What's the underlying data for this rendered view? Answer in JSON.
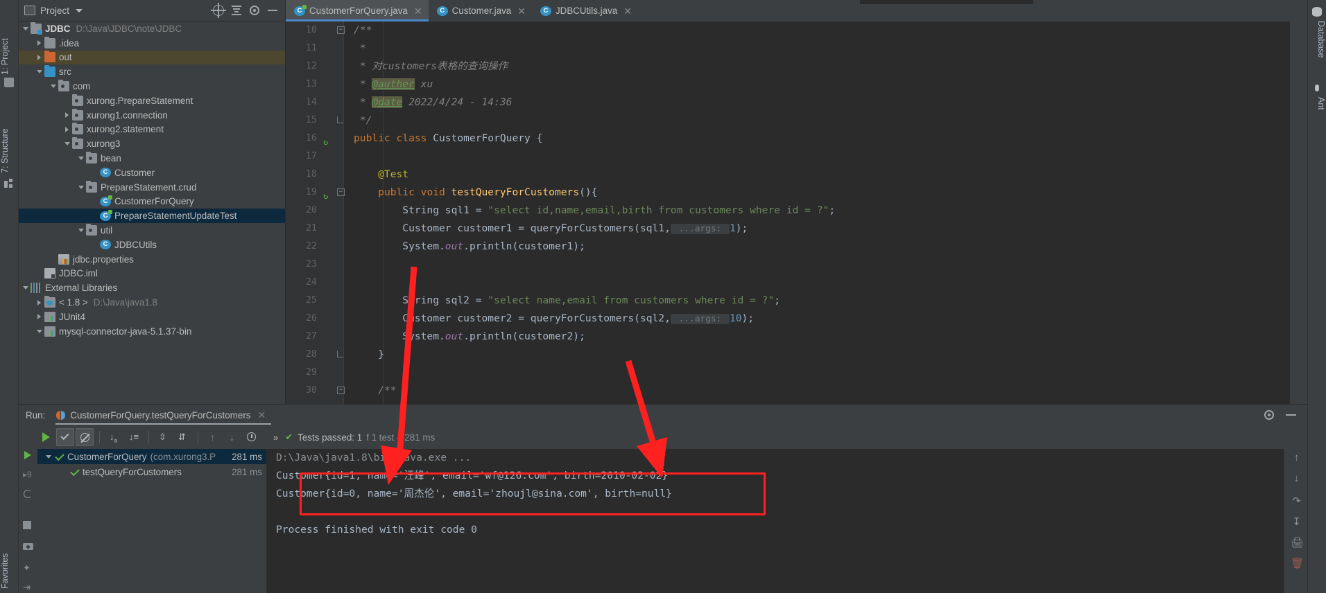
{
  "window": {
    "left_tool_labels": [
      "1: Project",
      "7: Structure",
      "Favorites"
    ],
    "right_tool_labels": [
      "Database",
      "Ant"
    ]
  },
  "project_panel": {
    "title": "Project",
    "toolbar_icons": [
      "locate-icon",
      "collapse-all-icon",
      "settings-icon",
      "hide-icon"
    ],
    "tree": [
      {
        "indent": 0,
        "arrow": "down",
        "icon": "folder-module",
        "label": "JDBC",
        "bold": true,
        "sub": "D:\\Java\\JDBC\\note\\JDBC",
        "state": "normal"
      },
      {
        "indent": 1,
        "arrow": "right",
        "icon": "folder",
        "label": ".idea",
        "sub": "",
        "state": "normal"
      },
      {
        "indent": 1,
        "arrow": "right",
        "icon": "folder-orange",
        "label": "out",
        "sub": "",
        "state": "highlight"
      },
      {
        "indent": 1,
        "arrow": "down",
        "icon": "folder-blue",
        "label": "src",
        "sub": "",
        "state": "normal"
      },
      {
        "indent": 2,
        "arrow": "down",
        "icon": "package",
        "label": "com",
        "sub": "",
        "state": "normal"
      },
      {
        "indent": 3,
        "arrow": "none",
        "icon": "package",
        "label": "xurong.PrepareStatement",
        "sub": "",
        "state": "normal"
      },
      {
        "indent": 3,
        "arrow": "right",
        "icon": "package",
        "label": "xurong1.connection",
        "sub": "",
        "state": "normal"
      },
      {
        "indent": 3,
        "arrow": "right",
        "icon": "package",
        "label": "xurong2.statement",
        "sub": "",
        "state": "normal"
      },
      {
        "indent": 3,
        "arrow": "down",
        "icon": "package",
        "label": "xurong3",
        "sub": "",
        "state": "normal"
      },
      {
        "indent": 4,
        "arrow": "down",
        "icon": "package",
        "label": "bean",
        "sub": "",
        "state": "normal"
      },
      {
        "indent": 5,
        "arrow": "none",
        "icon": "class",
        "label": "Customer",
        "sub": "",
        "state": "normal"
      },
      {
        "indent": 4,
        "arrow": "down",
        "icon": "package",
        "label": "PrepareStatement.crud",
        "sub": "",
        "state": "normal"
      },
      {
        "indent": 5,
        "arrow": "none",
        "icon": "class-runnable",
        "label": "CustomerForQuery",
        "sub": "",
        "state": "normal"
      },
      {
        "indent": 5,
        "arrow": "none",
        "icon": "class-runnable",
        "label": "PrepareStatementUpdateTest",
        "sub": "",
        "state": "selected"
      },
      {
        "indent": 4,
        "arrow": "down",
        "icon": "package",
        "label": "util",
        "sub": "",
        "state": "normal"
      },
      {
        "indent": 5,
        "arrow": "none",
        "icon": "class",
        "label": "JDBCUtils",
        "sub": "",
        "state": "normal"
      },
      {
        "indent": 2,
        "arrow": "none",
        "icon": "properties",
        "label": "jdbc.properties",
        "sub": "",
        "state": "normal"
      },
      {
        "indent": 1,
        "arrow": "none",
        "icon": "iml",
        "label": "JDBC.iml",
        "sub": "",
        "state": "normal"
      },
      {
        "indent": 0,
        "arrow": "down",
        "icon": "libraries",
        "label": "External Libraries",
        "sub": "",
        "state": "normal"
      },
      {
        "indent": 1,
        "arrow": "right",
        "icon": "jdk",
        "label": "< 1.8 >",
        "sub": "D:\\Java\\java1.8",
        "state": "normal"
      },
      {
        "indent": 1,
        "arrow": "right",
        "icon": "jar",
        "label": "JUnit4",
        "sub": "",
        "state": "normal"
      },
      {
        "indent": 1,
        "arrow": "down",
        "icon": "jar",
        "label": "mysql-connector-java-5.1.37-bin",
        "sub": "",
        "state": "normal"
      }
    ]
  },
  "editor": {
    "tabs": [
      {
        "label": "CustomerForQuery.java",
        "icon": "class-runnable-icon",
        "active": true
      },
      {
        "label": "Customer.java",
        "icon": "class-icon",
        "active": false
      },
      {
        "label": "JDBCUtils.java",
        "icon": "class-icon",
        "active": false
      }
    ],
    "first_line_number": 10,
    "lines": [
      {
        "n": 10,
        "fold": "start",
        "gutter_mark": "",
        "tokens": [
          {
            "t": "/**",
            "c": "cmt"
          }
        ],
        "indent": 0
      },
      {
        "n": 11,
        "fold": "",
        "gutter_mark": "",
        "tokens": [
          {
            "t": " *",
            "c": "cmt"
          }
        ],
        "indent": 1
      },
      {
        "n": 12,
        "fold": "",
        "gutter_mark": "",
        "tokens": [
          {
            "t": " * 对customers表格的查询操作",
            "c": "cmt"
          }
        ],
        "indent": 1
      },
      {
        "n": 13,
        "fold": "",
        "gutter_mark": "",
        "tokens": [
          {
            "t": " * ",
            "c": "cmt"
          },
          {
            "t": "@auther",
            "c": "tagc"
          },
          {
            "t": " xu",
            "c": "cmt"
          }
        ],
        "indent": 1
      },
      {
        "n": 14,
        "fold": "",
        "gutter_mark": "",
        "tokens": [
          {
            "t": " * ",
            "c": "cmt"
          },
          {
            "t": "@date",
            "c": "tagc"
          },
          {
            "t": " 2022/4/24 - 14:36",
            "c": "cmt"
          }
        ],
        "indent": 1
      },
      {
        "n": 15,
        "fold": "end",
        "gutter_mark": "",
        "tokens": [
          {
            "t": " */",
            "c": "cmt"
          }
        ],
        "indent": 1
      },
      {
        "n": 16,
        "fold": "",
        "gutter_mark": "run",
        "tokens": [
          {
            "t": "public class ",
            "c": "kw"
          },
          {
            "t": "CustomerForQuery {",
            "c": "cm"
          }
        ],
        "indent": 0
      },
      {
        "n": 17,
        "fold": "",
        "gutter_mark": "",
        "tokens": [],
        "indent": 0
      },
      {
        "n": 18,
        "fold": "",
        "gutter_mark": "",
        "tokens": [
          {
            "t": "    @Test",
            "c": "anno"
          }
        ],
        "indent": 0
      },
      {
        "n": 19,
        "fold": "start",
        "gutter_mark": "run",
        "tokens": [
          {
            "t": "    ",
            "c": "cm"
          },
          {
            "t": "public void ",
            "c": "kw"
          },
          {
            "t": "testQueryForCustomers",
            "c": "fn"
          },
          {
            "t": "(){",
            "c": "cm"
          }
        ],
        "indent": 0
      },
      {
        "n": 20,
        "fold": "",
        "gutter_mark": "",
        "tokens": [
          {
            "t": "        String sql1 = ",
            "c": "cm"
          },
          {
            "t": "\"select id,name,email,birth from customers where id = ?\"",
            "c": "str"
          },
          {
            "t": ";",
            "c": "cm"
          }
        ],
        "indent": 0
      },
      {
        "n": 21,
        "fold": "",
        "gutter_mark": "",
        "tokens": [
          {
            "t": "        Customer customer1 = queryForCustomers(sql1,",
            "c": "cm"
          },
          {
            "t": " ...args: ",
            "c": "hint"
          },
          {
            "t": "1",
            "c": "num"
          },
          {
            "t": ");",
            "c": "cm"
          }
        ],
        "indent": 0
      },
      {
        "n": 22,
        "fold": "",
        "gutter_mark": "",
        "tokens": [
          {
            "t": "        System.",
            "c": "cm"
          },
          {
            "t": "out",
            "c": "fld"
          },
          {
            "t": ".println(customer1);",
            "c": "cm"
          }
        ],
        "indent": 0
      },
      {
        "n": 23,
        "fold": "",
        "gutter_mark": "",
        "tokens": [],
        "indent": 0
      },
      {
        "n": 24,
        "fold": "",
        "gutter_mark": "",
        "tokens": [],
        "indent": 0
      },
      {
        "n": 25,
        "fold": "",
        "gutter_mark": "",
        "tokens": [
          {
            "t": "        String sql2 = ",
            "c": "cm"
          },
          {
            "t": "\"select name,email from customers where id = ?\"",
            "c": "str"
          },
          {
            "t": ";",
            "c": "cm"
          }
        ],
        "indent": 0
      },
      {
        "n": 26,
        "fold": "",
        "gutter_mark": "",
        "tokens": [
          {
            "t": "        Customer customer2 = queryForCustomers(sql2,",
            "c": "cm"
          },
          {
            "t": " ...args: ",
            "c": "hint"
          },
          {
            "t": "10",
            "c": "num"
          },
          {
            "t": ");",
            "c": "cm"
          }
        ],
        "indent": 0
      },
      {
        "n": 27,
        "fold": "",
        "gutter_mark": "",
        "tokens": [
          {
            "t": "        System.",
            "c": "cm"
          },
          {
            "t": "out",
            "c": "fld"
          },
          {
            "t": ".println(customer2);",
            "c": "cm"
          }
        ],
        "indent": 0
      },
      {
        "n": 28,
        "fold": "end",
        "gutter_mark": "",
        "tokens": [
          {
            "t": "    }",
            "c": "cm"
          }
        ],
        "indent": 0
      },
      {
        "n": 29,
        "fold": "",
        "gutter_mark": "",
        "tokens": [],
        "indent": 0
      },
      {
        "n": 30,
        "fold": "start",
        "gutter_mark": "",
        "tokens": [
          {
            "t": "    /**",
            "c": "cmt"
          }
        ],
        "indent": 0
      }
    ]
  },
  "run_window": {
    "label": "Run:",
    "config_name": "CustomerForQuery.testQueryForCustomers",
    "toolbar": {
      "rerun": "rerun-button",
      "toggle_passed": "show-passed-toggle",
      "toggle_ignored": "show-ignored-toggle",
      "sort_alpha": "sort-alphabetically-button",
      "sort_duration": "sort-by-duration-button",
      "expand_all": "expand-all-button",
      "collapse_all": "collapse-all-button",
      "prev_test": "previous-failed-test-button",
      "next_test": "next-failed-test-button",
      "history": "test-history-button",
      "more": "»"
    },
    "status": {
      "prefix": "Tests passed: 1",
      "suffix": "f 1 test – 281 ms"
    },
    "tests": [
      {
        "indent": 0,
        "arrow": "down",
        "name": "CustomerForQuery",
        "pkg": "(com.xurong3.P",
        "time": "281 ms",
        "selected": true
      },
      {
        "indent": 1,
        "arrow": "none",
        "name": "testQueryForCustomers",
        "pkg": "",
        "time": "281 ms",
        "selected": false
      }
    ],
    "console": [
      {
        "text": "D:\\Java\\java1.8\\bin\\java.exe ...",
        "style": "cmd"
      },
      {
        "text": "Customer{id=1, name='汪峰', email='wf@126.com', birth=2010-02-02}",
        "style": "out"
      },
      {
        "text": "Customer{id=0, name='周杰伦', email='zhoujl@sina.com', birth=null}",
        "style": "out"
      },
      {
        "text": "",
        "style": "out"
      },
      {
        "text": "Process finished with exit code 0",
        "style": "out"
      }
    ],
    "left_icons": [
      "run-icon",
      "rerun-failed-icon",
      "rerun-auto-icon"
    ],
    "right_icons": [
      "scroll-up-icon",
      "scroll-down-icon",
      "soft-wrap-icon",
      "scroll-to-end-icon",
      "print-icon",
      "clear-all-icon"
    ]
  },
  "annotations": {
    "highlight_color": "#ff2020",
    "arrow_count": 2,
    "description": "two red arrows pointing to red-outlined console output"
  }
}
